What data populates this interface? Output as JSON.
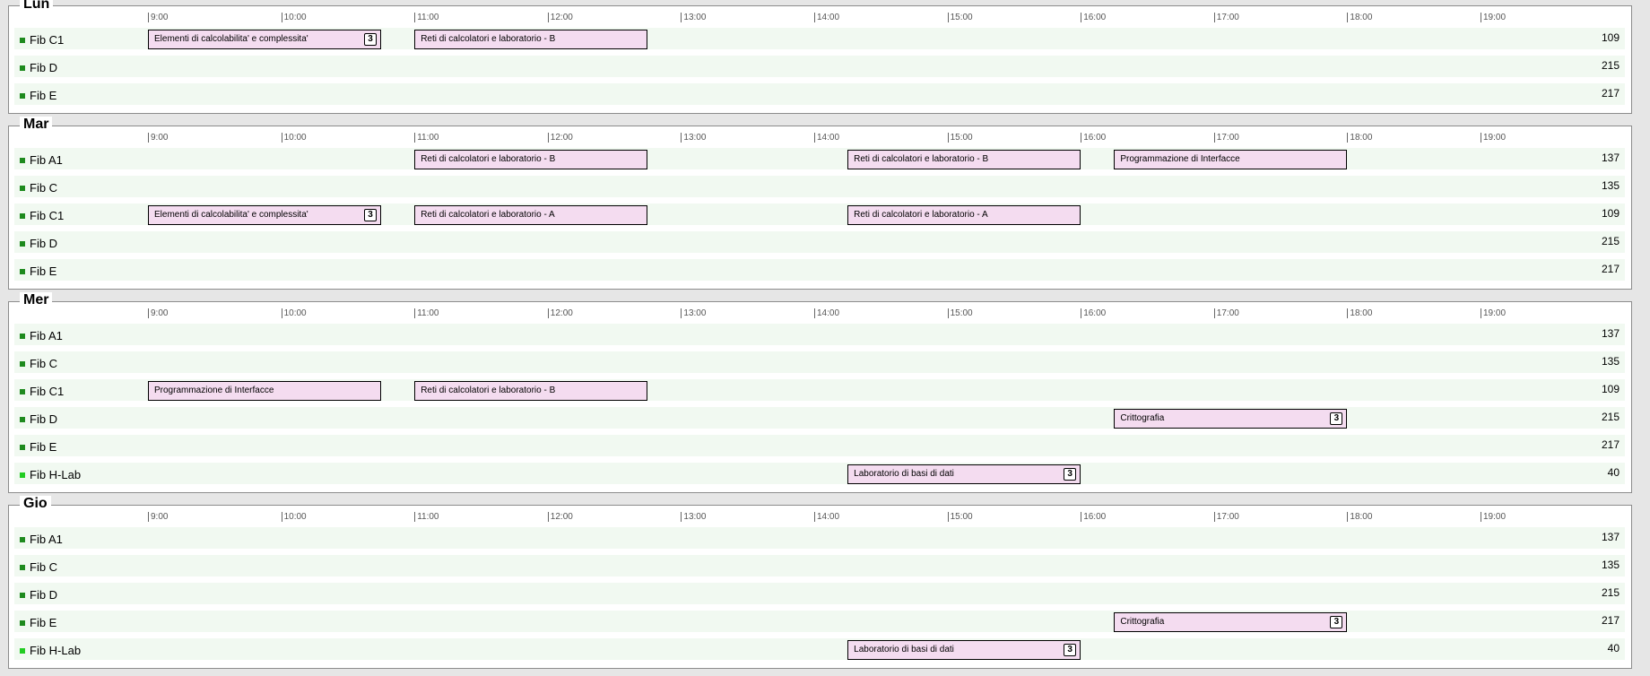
{
  "hours": [
    "9:00",
    "10:00",
    "11:00",
    "12:00",
    "13:00",
    "14:00",
    "15:00",
    "16:00",
    "17:00",
    "18:00",
    "19:00"
  ],
  "days": [
    {
      "name": "Lun",
      "rooms": [
        {
          "name": "Fib C1",
          "capacity": "109",
          "lab": false,
          "events": [
            {
              "title": "Elementi di calcolabilita' e complessita'",
              "badge": "3",
              "start": 9,
              "end": 10.75
            },
            {
              "title": "Reti di calcolatori e laboratorio - B",
              "badge": "",
              "start": 11,
              "end": 12.75
            }
          ]
        },
        {
          "name": "Fib D",
          "capacity": "215",
          "lab": false,
          "events": []
        },
        {
          "name": "Fib E",
          "capacity": "217",
          "lab": false,
          "events": []
        }
      ]
    },
    {
      "name": "Mar",
      "rooms": [
        {
          "name": "Fib A1",
          "capacity": "137",
          "lab": false,
          "events": [
            {
              "title": "Reti di calcolatori e laboratorio - B",
              "badge": "",
              "start": 11,
              "end": 12.75
            },
            {
              "title": "Reti di calcolatori e laboratorio - B",
              "badge": "",
              "start": 14.25,
              "end": 16
            },
            {
              "title": "Programmazione di Interfacce",
              "badge": "",
              "start": 16.25,
              "end": 18
            }
          ]
        },
        {
          "name": "Fib C",
          "capacity": "135",
          "lab": false,
          "events": []
        },
        {
          "name": "Fib C1",
          "capacity": "109",
          "lab": false,
          "events": [
            {
              "title": "Elementi di calcolabilita' e complessita'",
              "badge": "3",
              "start": 9,
              "end": 10.75
            },
            {
              "title": "Reti di calcolatori e laboratorio - A",
              "badge": "",
              "start": 11,
              "end": 12.75
            },
            {
              "title": "Reti di calcolatori e laboratorio - A",
              "badge": "",
              "start": 14.25,
              "end": 16
            }
          ]
        },
        {
          "name": "Fib D",
          "capacity": "215",
          "lab": false,
          "events": []
        },
        {
          "name": "Fib E",
          "capacity": "217",
          "lab": false,
          "events": []
        }
      ]
    },
    {
      "name": "Mer",
      "rooms": [
        {
          "name": "Fib A1",
          "capacity": "137",
          "lab": false,
          "events": []
        },
        {
          "name": "Fib C",
          "capacity": "135",
          "lab": false,
          "events": []
        },
        {
          "name": "Fib C1",
          "capacity": "109",
          "lab": false,
          "events": [
            {
              "title": "Programmazione di Interfacce",
              "badge": "",
              "start": 9,
              "end": 10.75
            },
            {
              "title": "Reti di calcolatori e laboratorio - B",
              "badge": "",
              "start": 11,
              "end": 12.75
            }
          ]
        },
        {
          "name": "Fib D",
          "capacity": "215",
          "lab": false,
          "events": [
            {
              "title": "Crittografia",
              "badge": "3",
              "start": 16.25,
              "end": 18
            }
          ]
        },
        {
          "name": "Fib E",
          "capacity": "217",
          "lab": false,
          "events": []
        },
        {
          "name": "Fib H-Lab",
          "capacity": "40",
          "lab": true,
          "events": [
            {
              "title": "Laboratorio di basi di dati",
              "badge": "3",
              "start": 14.25,
              "end": 16
            }
          ]
        }
      ]
    },
    {
      "name": "Gio",
      "rooms": [
        {
          "name": "Fib A1",
          "capacity": "137",
          "lab": false,
          "events": []
        },
        {
          "name": "Fib C",
          "capacity": "135",
          "lab": false,
          "events": []
        },
        {
          "name": "Fib D",
          "capacity": "215",
          "lab": false,
          "events": []
        },
        {
          "name": "Fib E",
          "capacity": "217",
          "lab": false,
          "events": [
            {
              "title": "Crittografia",
              "badge": "3",
              "start": 16.25,
              "end": 18
            }
          ]
        },
        {
          "name": "Fib H-Lab",
          "capacity": "40",
          "lab": true,
          "events": [
            {
              "title": "Laboratorio di basi di dati",
              "badge": "3",
              "start": 14.25,
              "end": 16
            }
          ]
        }
      ]
    }
  ]
}
